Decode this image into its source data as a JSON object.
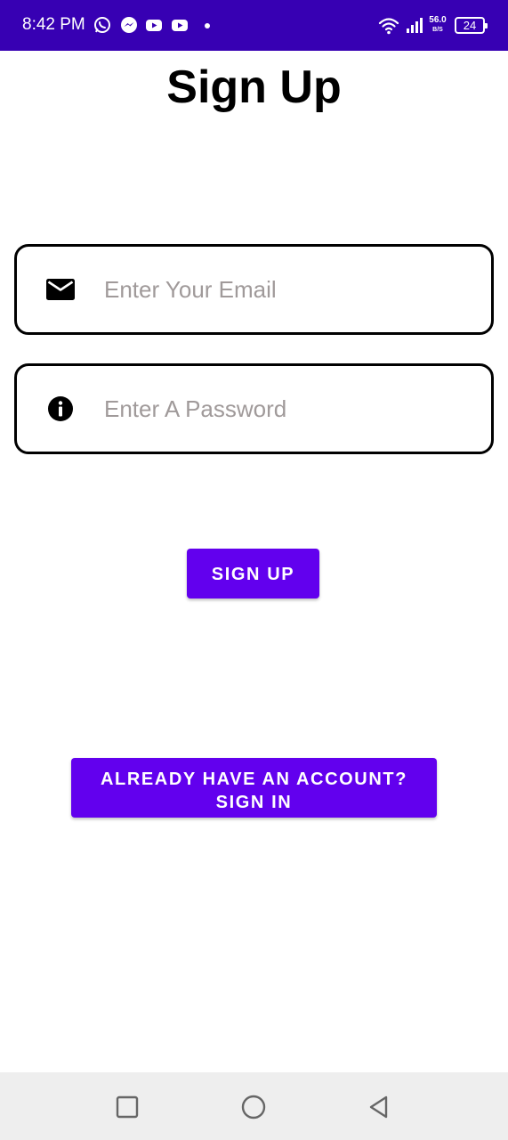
{
  "status_bar": {
    "time": "8:42 PM",
    "notification_icons": [
      "whatsapp-icon",
      "messenger-icon",
      "youtube-icon",
      "youtube-icon"
    ],
    "network_speed_value": "56.0",
    "network_speed_unit": "B/S",
    "battery_level": "24",
    "background_color": "#3700b3"
  },
  "page": {
    "title": "Sign Up"
  },
  "form": {
    "email": {
      "icon": "mail-icon",
      "placeholder": "Enter Your Email",
      "value": ""
    },
    "password": {
      "icon": "info-icon",
      "placeholder": "Enter A Password",
      "value": ""
    }
  },
  "buttons": {
    "sign_up": "SIGN UP",
    "sign_in_line1": "ALREADY HAVE AN ACCOUNT?",
    "sign_in_line2": "SIGN IN",
    "accent_color": "#6200ee"
  },
  "nav_bar": {
    "items": [
      "recents-icon",
      "home-icon",
      "back-icon"
    ]
  }
}
